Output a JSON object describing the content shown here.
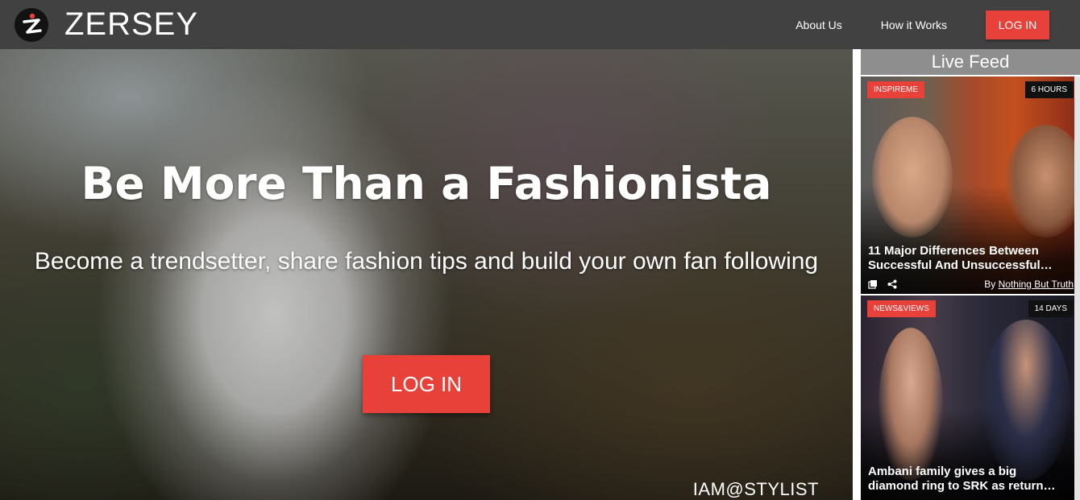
{
  "brand": {
    "name": "ZERSEY",
    "logo_icon": "zersey-logo-icon"
  },
  "nav": {
    "links": [
      "About Us",
      "How it Works"
    ],
    "login_label": "LOG IN",
    "accent_color": "#e8413a"
  },
  "hero": {
    "title": "Be More Than a Fashionista",
    "subtitle": "Become a trendsetter, share fashion tips and build your own fan following",
    "login_label": "LOG IN",
    "credit": "IAM@STYLIST"
  },
  "feed": {
    "header": "Live Feed",
    "cards": [
      {
        "tag": "INSPIREME",
        "age": "6 HOURS",
        "title_line1": "11 Major Differences Between",
        "title_line2": "Successful And Unsuccessful…",
        "by_prefix": "By",
        "author": "Nothing But Truth"
      },
      {
        "tag": "NEWS&VIEWS",
        "age": "14 DAYS",
        "title_line1": "Ambani family gives a big",
        "title_line2": "diamond ring to SRK as return…"
      }
    ]
  }
}
